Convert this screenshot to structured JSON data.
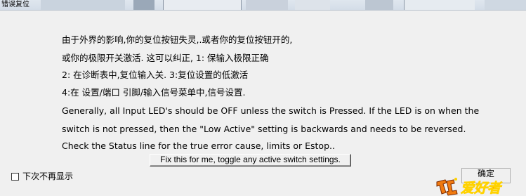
{
  "window": {
    "title": "错误复位"
  },
  "message": {
    "lines": [
      "由于外界的影响,你的复位按钮失灵,.或者你的复位按钮开的,",
      "或你的极限开关激活. 这可以纠正, 1: 保输入极限正确",
      "2: 在诊断表中,复位输入关. 3:复位设置的低激活",
      "4:在 设置/端口  引脚/输入信号菜单中,信号设置.",
      "Generally, all Input LED's should be OFF unless the switch is Pressed. If the LED is on when the",
      "switch is not pressed, then the \"Low Active\" setting is backwards and needs to be reversed.",
      "Check the Status line for the true error cause, limits or Estop.."
    ]
  },
  "buttons": {
    "fix_label": "Fix this for me, toggle any active switch settings.",
    "ok_label": "确定"
  },
  "checkbox": {
    "label": "下次不再显示",
    "checked": false
  },
  "watermark": {
    "text": "爱好者",
    "colors": {
      "orange": "#f07a10",
      "red": "#e01818",
      "yellow": "#ffd200"
    }
  }
}
